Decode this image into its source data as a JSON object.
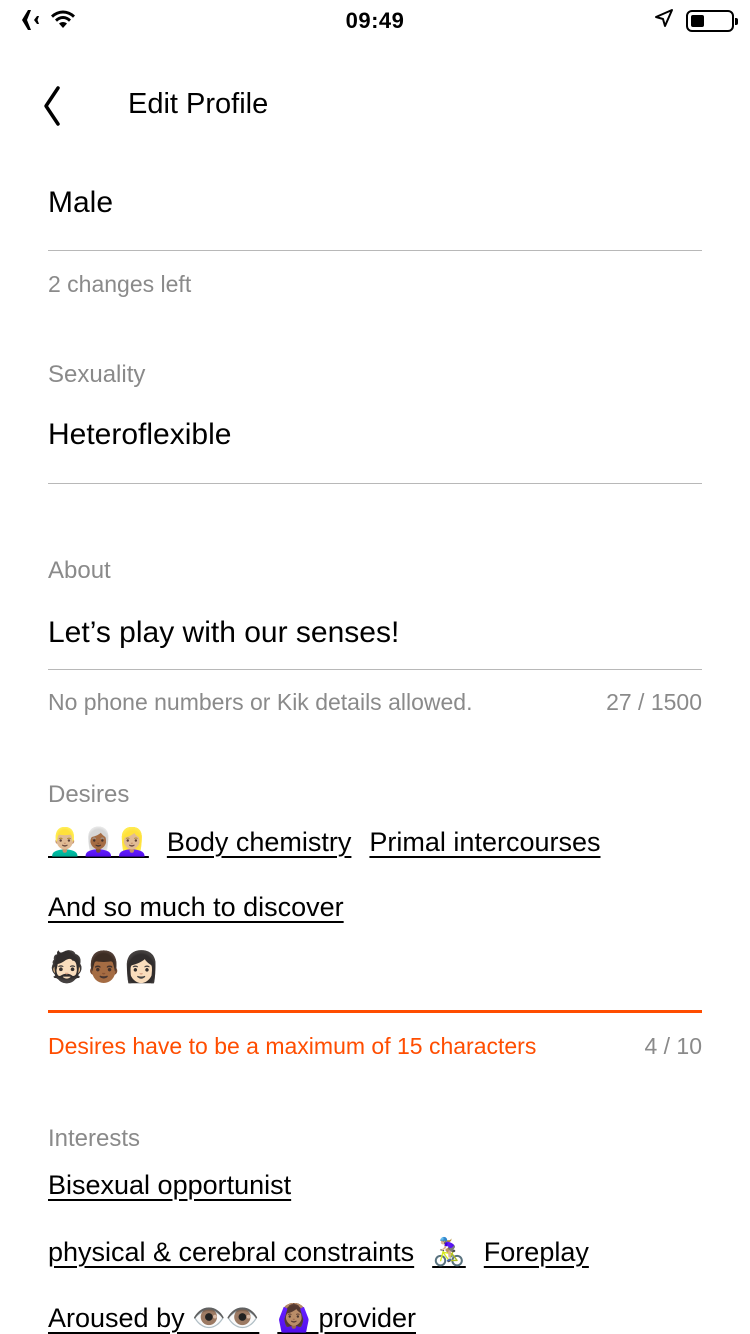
{
  "status_bar": {
    "time": "09:49",
    "airplane_icon": "airplane-icon",
    "wifi_icon": "wifi-icon",
    "location_icon": "location-arrow-icon",
    "battery_level": 0.35
  },
  "nav": {
    "title": "Edit Profile",
    "back_icon": "chevron-left-icon"
  },
  "gender": {
    "value": "Male",
    "helper": "2 changes left"
  },
  "sexuality": {
    "label": "Sexuality",
    "value": "Heteroflexible"
  },
  "about": {
    "label": "About",
    "value": "Let’s play with our senses!",
    "helper": "No phone numbers or Kik details allowed.",
    "counter": "27 / 1500"
  },
  "desires": {
    "label": "Desires",
    "tags_row1": [
      {
        "text": "👱🏼‍♂️👩🏾‍🦳👱🏼‍♀️",
        "kind": "emoji"
      },
      {
        "text": "Body chemistry",
        "kind": "text"
      },
      {
        "text": "Primal intercourses",
        "kind": "text"
      }
    ],
    "tags_row2": [
      {
        "text": "And so much to discover",
        "kind": "text"
      }
    ],
    "input_value": "🧔🏻👨🏾👩🏻",
    "error": "Desires have to be a maximum of 15 characters",
    "counter": "4 / 10",
    "error_color": "#ff4d00"
  },
  "interests": {
    "label": "Interests",
    "tags_row1": [
      {
        "text": "Bisexual opportunist",
        "kind": "text"
      }
    ],
    "tags_row2": [
      {
        "text": "physical & cerebral constraints",
        "kind": "text"
      },
      {
        "text": "🚴🏼‍♀️",
        "kind": "emoji"
      },
      {
        "text": "Foreplay",
        "kind": "text"
      }
    ],
    "tags_row3": [
      {
        "text": "Aroused by 👁️👁️",
        "kind": "text"
      },
      {
        "text": "🙆🏽‍♀️ provider",
        "kind": "text"
      }
    ]
  }
}
